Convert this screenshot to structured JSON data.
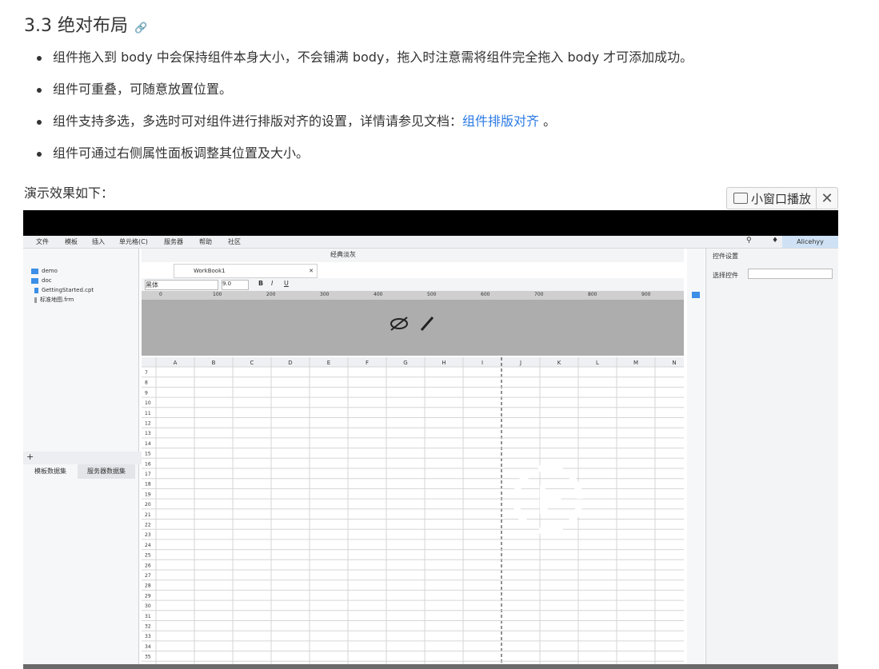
{
  "doc": {
    "section_title": "3.3 绝对布局",
    "bullets": [
      "组件拖入到 body 中会保持组件本身大小，不会铺满 body，拖入时注意需将组件完全拖入 body 才可添加成功。",
      "组件可重叠，可随意放置位置。",
      "组件支持多选，多选时可对组件进行排版对齐的设置，详情请参见文档：",
      "组件可通过右侧属性面板调整其位置及大小。"
    ],
    "bullet3_link": "组件排版对齐",
    "bullet3_tail": " 。",
    "demo_note": "演示效果如下：",
    "mini_player_label": "小窗口播放"
  },
  "app": {
    "menu": [
      "文件",
      "模板",
      "插入",
      "单元格(C)",
      "服务器",
      "帮助",
      "社区"
    ],
    "user": "Alicehyy",
    "tree": [
      "demo",
      "doc",
      "GettingStarted.cpt",
      "标准地图.frm"
    ],
    "dataset_tabs": [
      "模板数据集",
      "服务器数据集"
    ],
    "workbook_tab": "WorkBook1",
    "style_button": "经典淡灰",
    "font_name": "黑体",
    "font_size": "9.0",
    "ruler_ticks": [
      "0",
      "100",
      "200",
      "300",
      "400",
      "500",
      "600",
      "700",
      "800",
      "900"
    ],
    "columns": [
      "A",
      "B",
      "C",
      "D",
      "E",
      "F",
      "G",
      "H",
      "I",
      "J",
      "K",
      "L",
      "M",
      "N"
    ],
    "rows": [
      "7",
      "8",
      "9",
      "10",
      "11",
      "12",
      "13",
      "14",
      "15",
      "16",
      "17",
      "18",
      "19",
      "20",
      "21",
      "22",
      "23",
      "24",
      "25",
      "26",
      "27",
      "28",
      "29",
      "30",
      "31",
      "32",
      "33",
      "34",
      "35",
      "36"
    ],
    "props_title": "控件设置",
    "props_select_label": "选择控件"
  }
}
